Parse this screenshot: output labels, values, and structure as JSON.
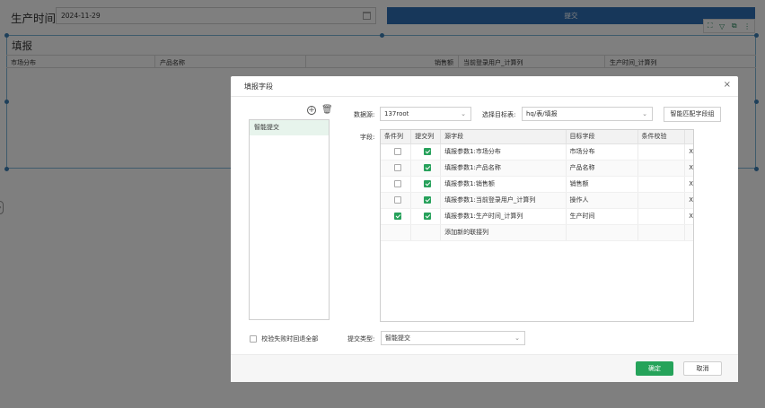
{
  "page": {
    "date_label": "生产时间",
    "date_value": "2024-11-29",
    "submit_label": "提交",
    "report_title": "填报",
    "report_columns": [
      "市场分布",
      "产品名称",
      "销售额",
      "当前登录用户_计算列",
      "生产时间_计算列"
    ],
    "toolbar_icons": [
      "expand-icon",
      "filter-icon",
      "export-icon",
      "more-icon"
    ]
  },
  "dialog": {
    "title": "填报字段",
    "close": "×",
    "left_items": [
      "智能提交"
    ],
    "datasource_label": "数据源:",
    "datasource_value": "137root",
    "target_label": "选择目标表:",
    "target_value": "hq/表/填报",
    "smart_match_label": "智能匹配字段组",
    "field_label": "字段:",
    "columns": [
      "条件列",
      "提交列",
      "源字段",
      "目标字段",
      "条件校验"
    ],
    "rows": [
      {
        "cond": false,
        "submit": true,
        "source": "填报参数1:市场分布",
        "target": "市场分布",
        "del": "X"
      },
      {
        "cond": false,
        "submit": true,
        "source": "填报参数1:产品名称",
        "target": "产品名称",
        "del": "X"
      },
      {
        "cond": false,
        "submit": true,
        "source": "填报参数1:销售额",
        "target": "销售额",
        "del": "X"
      },
      {
        "cond": false,
        "submit": true,
        "source": "填报参数1:当前登录用户_计算列",
        "target": "操作人",
        "del": "X"
      },
      {
        "cond": true,
        "submit": true,
        "source": "填报参数1:生产时间_计算列",
        "target": "生产时间",
        "del": "X"
      }
    ],
    "add_row_label": "添加新的联接列",
    "rollback_label": "校验失败时回退全部",
    "submit_type_label": "提交类型:",
    "submit_type_value": "智能提交",
    "ok_label": "确定",
    "cancel_label": "取消"
  },
  "colors": {
    "accent_green": "#25a35a",
    "submit_blue": "#2f6fb5",
    "overlay": "rgba(0,0,0,0.5)"
  }
}
